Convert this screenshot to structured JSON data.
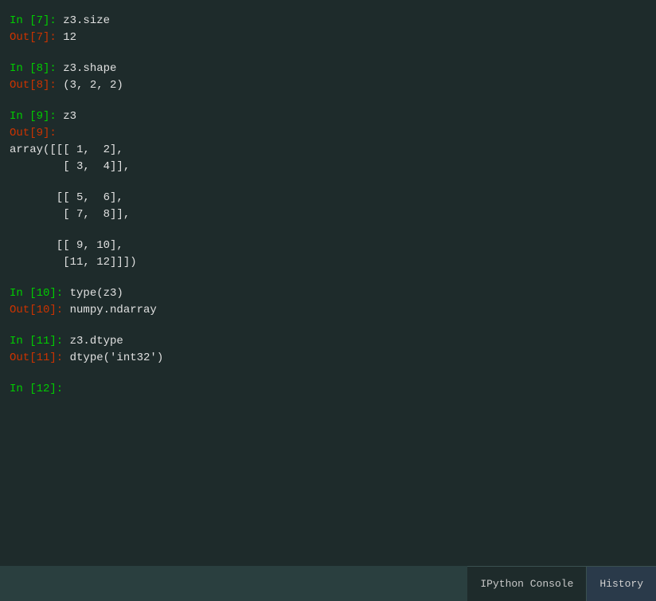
{
  "console": {
    "background": "#1e2b2b",
    "lines": [
      {
        "type": "in",
        "prompt": "In [7]:",
        "code": " z3.size"
      },
      {
        "type": "out",
        "prompt": "Out[7]:",
        "value": " 12"
      },
      {
        "type": "blank"
      },
      {
        "type": "in",
        "prompt": "In [8]:",
        "code": " z3.shape"
      },
      {
        "type": "out",
        "prompt": "Out[8]:",
        "value": " (3, 2, 2)"
      },
      {
        "type": "blank"
      },
      {
        "type": "in",
        "prompt": "In [9]:",
        "code": " z3"
      },
      {
        "type": "out",
        "prompt": "Out[9]:",
        "value": ""
      },
      {
        "type": "text",
        "value": "array([[[ 1,  2],"
      },
      {
        "type": "text",
        "value": "        [ 3,  4]],"
      },
      {
        "type": "blank"
      },
      {
        "type": "text",
        "value": "       [[ 5,  6],"
      },
      {
        "type": "text",
        "value": "        [ 7,  8]],"
      },
      {
        "type": "blank"
      },
      {
        "type": "text",
        "value": "       [[ 9, 10],"
      },
      {
        "type": "text",
        "value": "        [11, 12]]])"
      },
      {
        "type": "blank"
      },
      {
        "type": "in",
        "prompt": "In [10]:",
        "code": " type(z3)"
      },
      {
        "type": "out",
        "prompt": "Out[10]:",
        "value": " numpy.ndarray"
      },
      {
        "type": "blank"
      },
      {
        "type": "in",
        "prompt": "In [11]:",
        "code": " z3.dtype"
      },
      {
        "type": "out",
        "prompt": "Out[11]:",
        "value": " dtype('int32')"
      },
      {
        "type": "blank"
      },
      {
        "type": "in",
        "prompt": "In [12]:",
        "code": ""
      }
    ]
  },
  "bottombar": {
    "tabs": [
      {
        "id": "ipython",
        "label": "IPython Console",
        "active": true
      },
      {
        "id": "history",
        "label": "History",
        "active": false
      }
    ]
  }
}
